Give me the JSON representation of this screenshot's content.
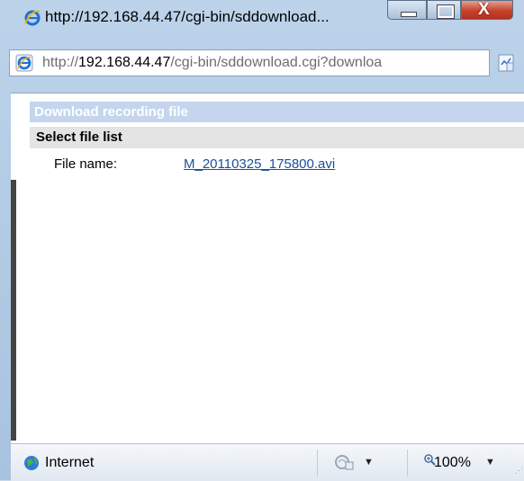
{
  "window": {
    "title": "http://192.168.44.47/cgi-bin/sddownload...",
    "close_glyph": "X"
  },
  "address": {
    "protocol": "http://",
    "host": "192.168.44.47",
    "path": "/cgi-bin/sddownload.cgi?downloa"
  },
  "page": {
    "title": "Download recording file",
    "section": "Select file list",
    "file_label": "File name:",
    "file_name": "M_20110325_175800.avi"
  },
  "status": {
    "zone": "Internet",
    "zoom": "100%",
    "dropdown_glyph": "▼"
  },
  "icons": [
    "ie-icon",
    "compatibility-view-icon",
    "globe-icon",
    "protected-mode-icon",
    "zoom-icon"
  ],
  "colors": {
    "page_title_bg": "#c5d5ee",
    "section_bg": "#e4e4e4",
    "link": "#1c4f9e",
    "close_button": "#c4422b"
  }
}
